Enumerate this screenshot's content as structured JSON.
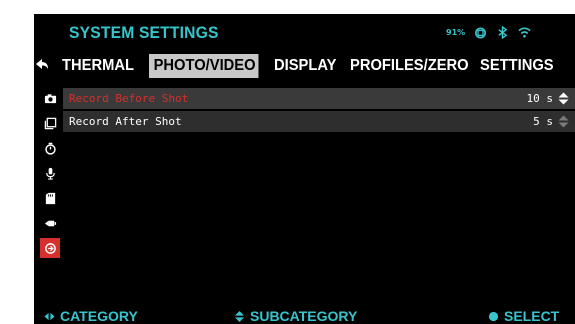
{
  "header": {
    "title": "SYSTEM SETTINGS",
    "battery": "91%",
    "icons": [
      "power-icon",
      "bluetooth-icon",
      "wifi-icon"
    ]
  },
  "tabs": [
    {
      "label": "THERMAL",
      "active": false
    },
    {
      "label": "PHOTO/VIDEO",
      "active": true
    },
    {
      "label": "DISPLAY",
      "active": false
    },
    {
      "label": "PROFILES/ZERO",
      "active": false
    },
    {
      "label": "SETTINGS",
      "active": false
    }
  ],
  "categories": [
    {
      "icon": "camera-icon",
      "active": false
    },
    {
      "icon": "gallery-icon",
      "active": false
    },
    {
      "icon": "timer-icon",
      "active": false
    },
    {
      "icon": "microphone-icon",
      "active": false
    },
    {
      "icon": "sd-card-icon",
      "active": false
    },
    {
      "icon": "video-camera-icon",
      "active": false
    },
    {
      "icon": "record-shot-icon",
      "active": true
    }
  ],
  "settings": [
    {
      "label": "Record Before Shot",
      "value": "10 s",
      "highlighted": true
    },
    {
      "label": "Record After Shot",
      "value": "5 s",
      "highlighted": false
    }
  ],
  "footer": {
    "category": "CATEGORY",
    "subcategory": "SUBCATEGORY",
    "select": "SELECT"
  },
  "colors": {
    "accent": "#37c4cc",
    "highlight": "#d5302c",
    "active_tab": "#c8c8c8"
  }
}
